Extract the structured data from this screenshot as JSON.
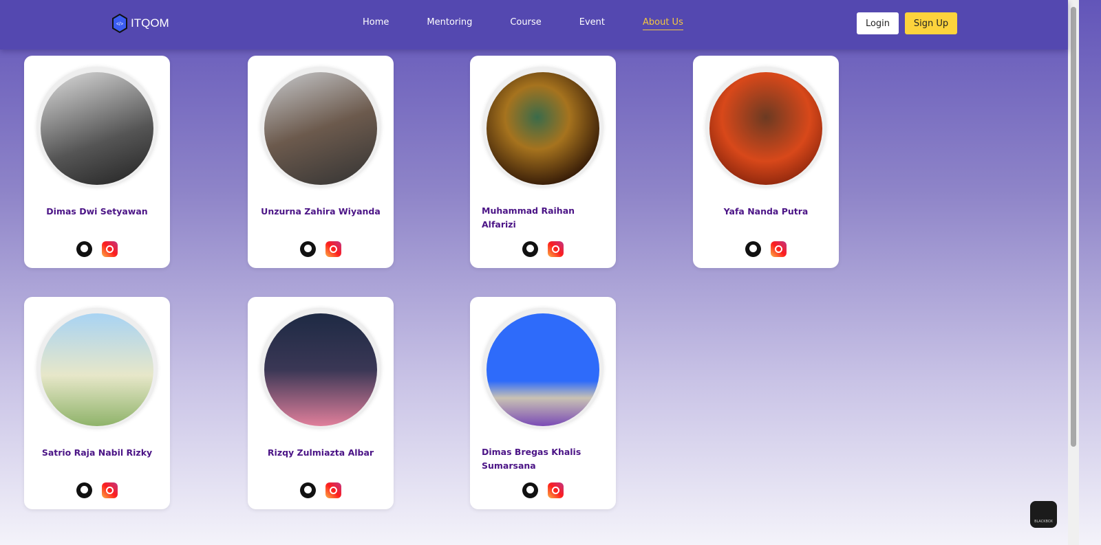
{
  "brand": {
    "name": "ITQOM",
    "icon": "code-hexagon-icon"
  },
  "nav": [
    {
      "label": "Home"
    },
    {
      "label": "Mentoring"
    },
    {
      "label": "Course"
    },
    {
      "label": "Event"
    },
    {
      "label": "About Us",
      "active": true
    }
  ],
  "auth": {
    "login": "Login",
    "signup": "Sign Up"
  },
  "team": [
    {
      "name": "Dimas Dwi Setyawan",
      "avatar": "linear-gradient(160deg,#ddd,#555 60%,#222)"
    },
    {
      "name": "Unzurna Zahira Wiyanda",
      "avatar": "linear-gradient(160deg,#c7c9cc,#6c5a4d 50%,#333)"
    },
    {
      "name": "Muhammad Raihan Alfarizi",
      "avatar": "radial-gradient(circle at 45% 40%,#3a6b4a,#a6731e 35%,#2a1205 80%)"
    },
    {
      "name": "Yafa Nanda Putra",
      "avatar": "radial-gradient(circle at 50% 40%,#6b3a22,#d8481a 50%,#5a1004)"
    },
    {
      "name": "Satrio Raja Nabil Rizky",
      "avatar": "linear-gradient(180deg,#a8d3f3,#e7e7c9 55%,#8fb36a)"
    },
    {
      "name": "Rizqy Zulmiazta Albar",
      "avatar": "linear-gradient(180deg,#1e2a44,#3a3755 50%,#e07f9b)"
    },
    {
      "name": "Dimas Bregas Khalis Sumarsana",
      "avatar": "linear-gradient(180deg,#2e6bfa 60%,#c9c2b4 75%,#7a4bb5)"
    }
  ],
  "widget": {
    "label": "BLACKBOX"
  }
}
